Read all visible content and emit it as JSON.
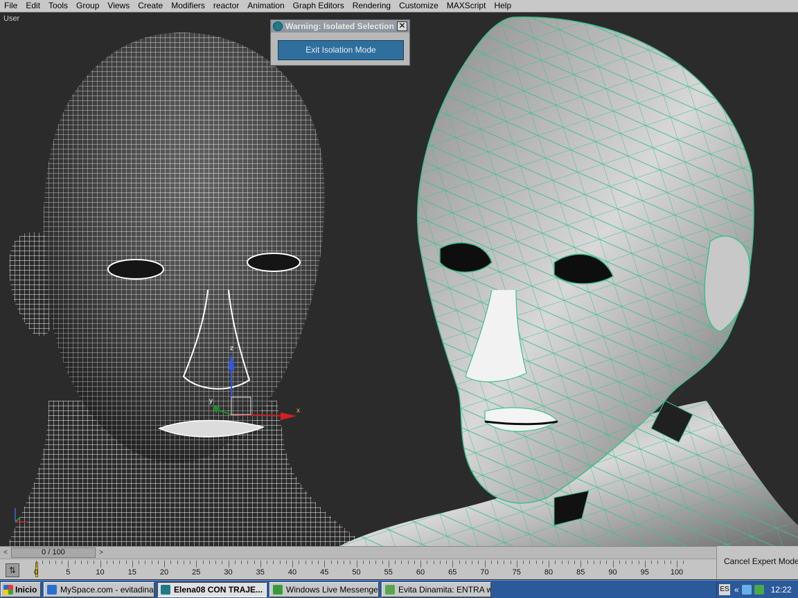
{
  "menubar": {
    "items": [
      "File",
      "Edit",
      "Tools",
      "Group",
      "Views",
      "Create",
      "Modifiers",
      "reactor",
      "Animation",
      "Graph Editors",
      "Rendering",
      "Customize",
      "MAXScript",
      "Help"
    ]
  },
  "viewport": {
    "label": "User",
    "gizmo": {
      "z": "z",
      "y": "y",
      "x": "x"
    }
  },
  "warning_dialog": {
    "title": "Warning: Isolated Selection",
    "close_glyph": "✕",
    "exit_button": "Exit Isolation Mode"
  },
  "time_slider": {
    "value": "0 / 100",
    "left_arrow": "<",
    "right_arrow": ">"
  },
  "trackbar": {
    "ticks": [
      "0",
      "5",
      "10",
      "15",
      "20",
      "25",
      "30",
      "35",
      "40",
      "45",
      "50",
      "55",
      "60",
      "65",
      "70",
      "75",
      "80",
      "85",
      "90",
      "95",
      "100"
    ],
    "key_glyph": "⇅"
  },
  "expert": {
    "cancel_label": "Cancel Expert Mode"
  },
  "taskbar": {
    "start_label": "Inicio",
    "tasks": [
      {
        "label": "MySpace.com - evitadina...",
        "icon_color": "#2a6fd0",
        "active": false
      },
      {
        "label": "Elena08 CON TRAJE...",
        "icon_color": "#1f7a8a",
        "active": true
      },
      {
        "label": "Windows Live Messenger",
        "icon_color": "#3a9a3a",
        "active": false
      },
      {
        "label": "Evita Dinamita: ENTRA w...",
        "icon_color": "#5aa64a",
        "active": false
      }
    ],
    "tray": {
      "lang": "ES",
      "chevron": "«",
      "clock": "12:22"
    }
  },
  "colors": {
    "viewport_bg": "#2b2b2b",
    "wire_green": "#3ec08a",
    "dialog_button": "#2e6f9e",
    "taskbar": "#2a5a9a"
  }
}
